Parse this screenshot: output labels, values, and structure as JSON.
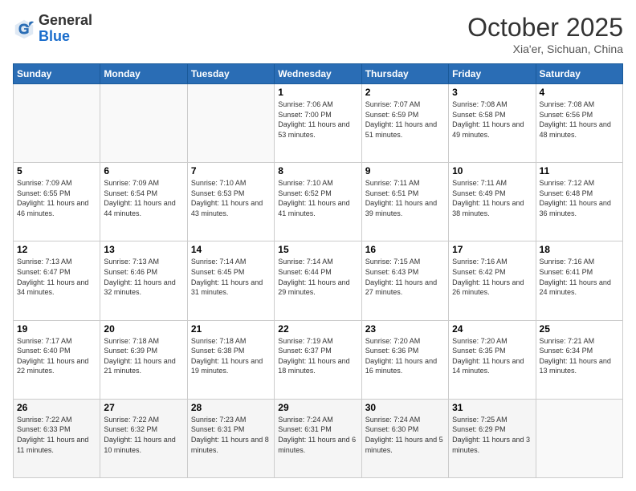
{
  "header": {
    "logo_general": "General",
    "logo_blue": "Blue",
    "month_title": "October 2025",
    "location": "Xia'er, Sichuan, China"
  },
  "days_of_week": [
    "Sunday",
    "Monday",
    "Tuesday",
    "Wednesday",
    "Thursday",
    "Friday",
    "Saturday"
  ],
  "weeks": [
    [
      {
        "day": "",
        "info": ""
      },
      {
        "day": "",
        "info": ""
      },
      {
        "day": "",
        "info": ""
      },
      {
        "day": "1",
        "info": "Sunrise: 7:06 AM\nSunset: 7:00 PM\nDaylight: 11 hours and 53 minutes."
      },
      {
        "day": "2",
        "info": "Sunrise: 7:07 AM\nSunset: 6:59 PM\nDaylight: 11 hours and 51 minutes."
      },
      {
        "day": "3",
        "info": "Sunrise: 7:08 AM\nSunset: 6:58 PM\nDaylight: 11 hours and 49 minutes."
      },
      {
        "day": "4",
        "info": "Sunrise: 7:08 AM\nSunset: 6:56 PM\nDaylight: 11 hours and 48 minutes."
      }
    ],
    [
      {
        "day": "5",
        "info": "Sunrise: 7:09 AM\nSunset: 6:55 PM\nDaylight: 11 hours and 46 minutes."
      },
      {
        "day": "6",
        "info": "Sunrise: 7:09 AM\nSunset: 6:54 PM\nDaylight: 11 hours and 44 minutes."
      },
      {
        "day": "7",
        "info": "Sunrise: 7:10 AM\nSunset: 6:53 PM\nDaylight: 11 hours and 43 minutes."
      },
      {
        "day": "8",
        "info": "Sunrise: 7:10 AM\nSunset: 6:52 PM\nDaylight: 11 hours and 41 minutes."
      },
      {
        "day": "9",
        "info": "Sunrise: 7:11 AM\nSunset: 6:51 PM\nDaylight: 11 hours and 39 minutes."
      },
      {
        "day": "10",
        "info": "Sunrise: 7:11 AM\nSunset: 6:49 PM\nDaylight: 11 hours and 38 minutes."
      },
      {
        "day": "11",
        "info": "Sunrise: 7:12 AM\nSunset: 6:48 PM\nDaylight: 11 hours and 36 minutes."
      }
    ],
    [
      {
        "day": "12",
        "info": "Sunrise: 7:13 AM\nSunset: 6:47 PM\nDaylight: 11 hours and 34 minutes."
      },
      {
        "day": "13",
        "info": "Sunrise: 7:13 AM\nSunset: 6:46 PM\nDaylight: 11 hours and 32 minutes."
      },
      {
        "day": "14",
        "info": "Sunrise: 7:14 AM\nSunset: 6:45 PM\nDaylight: 11 hours and 31 minutes."
      },
      {
        "day": "15",
        "info": "Sunrise: 7:14 AM\nSunset: 6:44 PM\nDaylight: 11 hours and 29 minutes."
      },
      {
        "day": "16",
        "info": "Sunrise: 7:15 AM\nSunset: 6:43 PM\nDaylight: 11 hours and 27 minutes."
      },
      {
        "day": "17",
        "info": "Sunrise: 7:16 AM\nSunset: 6:42 PM\nDaylight: 11 hours and 26 minutes."
      },
      {
        "day": "18",
        "info": "Sunrise: 7:16 AM\nSunset: 6:41 PM\nDaylight: 11 hours and 24 minutes."
      }
    ],
    [
      {
        "day": "19",
        "info": "Sunrise: 7:17 AM\nSunset: 6:40 PM\nDaylight: 11 hours and 22 minutes."
      },
      {
        "day": "20",
        "info": "Sunrise: 7:18 AM\nSunset: 6:39 PM\nDaylight: 11 hours and 21 minutes."
      },
      {
        "day": "21",
        "info": "Sunrise: 7:18 AM\nSunset: 6:38 PM\nDaylight: 11 hours and 19 minutes."
      },
      {
        "day": "22",
        "info": "Sunrise: 7:19 AM\nSunset: 6:37 PM\nDaylight: 11 hours and 18 minutes."
      },
      {
        "day": "23",
        "info": "Sunrise: 7:20 AM\nSunset: 6:36 PM\nDaylight: 11 hours and 16 minutes."
      },
      {
        "day": "24",
        "info": "Sunrise: 7:20 AM\nSunset: 6:35 PM\nDaylight: 11 hours and 14 minutes."
      },
      {
        "day": "25",
        "info": "Sunrise: 7:21 AM\nSunset: 6:34 PM\nDaylight: 11 hours and 13 minutes."
      }
    ],
    [
      {
        "day": "26",
        "info": "Sunrise: 7:22 AM\nSunset: 6:33 PM\nDaylight: 11 hours and 11 minutes."
      },
      {
        "day": "27",
        "info": "Sunrise: 7:22 AM\nSunset: 6:32 PM\nDaylight: 11 hours and 10 minutes."
      },
      {
        "day": "28",
        "info": "Sunrise: 7:23 AM\nSunset: 6:31 PM\nDaylight: 11 hours and 8 minutes."
      },
      {
        "day": "29",
        "info": "Sunrise: 7:24 AM\nSunset: 6:31 PM\nDaylight: 11 hours and 6 minutes."
      },
      {
        "day": "30",
        "info": "Sunrise: 7:24 AM\nSunset: 6:30 PM\nDaylight: 11 hours and 5 minutes."
      },
      {
        "day": "31",
        "info": "Sunrise: 7:25 AM\nSunset: 6:29 PM\nDaylight: 11 hours and 3 minutes."
      },
      {
        "day": "",
        "info": ""
      }
    ]
  ]
}
